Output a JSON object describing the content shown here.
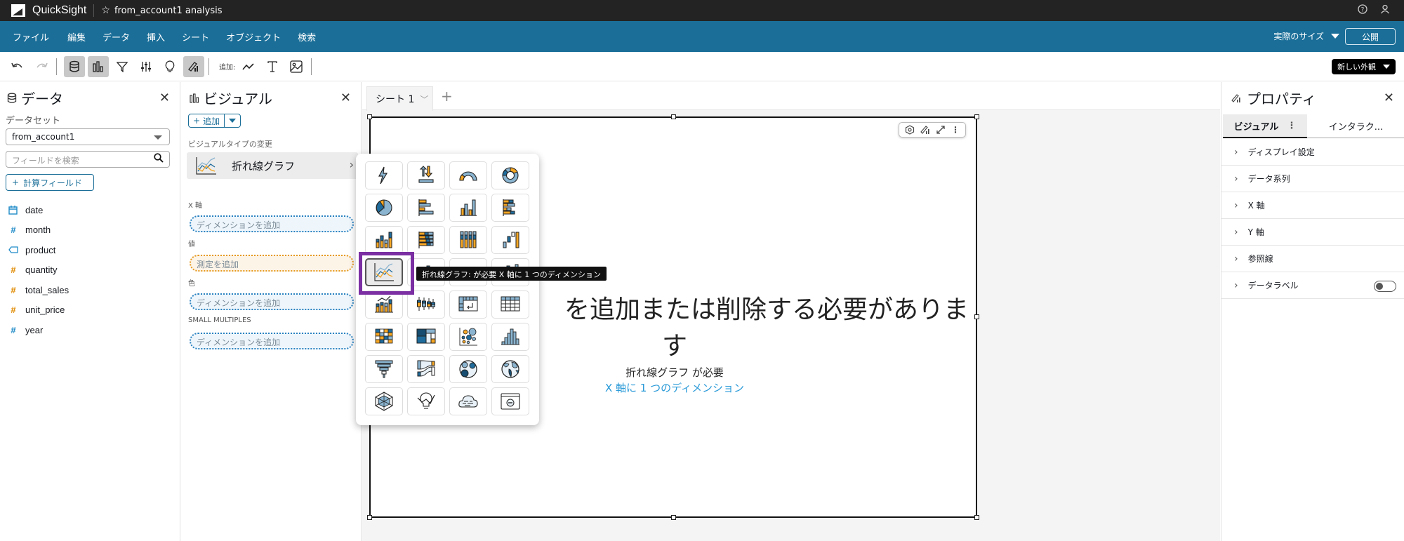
{
  "app": {
    "name": "QuickSight",
    "analysis_title": "from_account1 analysis",
    "icons": [
      "help-icon",
      "user-icon"
    ]
  },
  "menubar": {
    "items": [
      "ファイル",
      "編集",
      "データ",
      "挿入",
      "シート",
      "オブジェクト",
      "検索"
    ],
    "size_selector": "実際のサイズ",
    "publish": "公開"
  },
  "toolbar": {
    "add_label": "追加:",
    "new_look": "新しい外観"
  },
  "data_panel": {
    "title": "データ",
    "dataset_label": "データセット",
    "dataset_value": "from_account1",
    "search_placeholder": "フィールドを検索",
    "calc_field_label": "計算フィールド",
    "fields": [
      {
        "name": "date",
        "type": "date",
        "icon": "calendar-icon",
        "color": "#1f8bc8"
      },
      {
        "name": "month",
        "type": "dimension-number",
        "icon": "hash-icon",
        "color": "#1f8bc8"
      },
      {
        "name": "product",
        "type": "string",
        "icon": "tag-icon",
        "color": "#1f8bc8"
      },
      {
        "name": "quantity",
        "type": "measure",
        "icon": "hash-icon",
        "color": "#e08a00"
      },
      {
        "name": "total_sales",
        "type": "measure",
        "icon": "hash-icon",
        "color": "#e08a00"
      },
      {
        "name": "unit_price",
        "type": "measure",
        "icon": "hash-icon",
        "color": "#e08a00"
      },
      {
        "name": "year",
        "type": "dimension-number",
        "icon": "hash-icon",
        "color": "#1f8bc8"
      }
    ]
  },
  "visual_panel": {
    "title": "ビジュアル",
    "add_label": "追加",
    "change_type_label": "ビジュアルタイプの変更",
    "current_type": "折れ線グラフ",
    "wells": [
      {
        "label": "X 軸",
        "placeholder": "ディメンションを追加",
        "kind": "dimension"
      },
      {
        "label": "値",
        "placeholder": "測定を追加",
        "kind": "measure"
      },
      {
        "label": "色",
        "placeholder": "ディメンションを追加",
        "kind": "dimension"
      },
      {
        "label": "SMALL MULTIPLES",
        "placeholder": "ディメンションを追加",
        "kind": "dimension"
      }
    ]
  },
  "sheet": {
    "tab_label": "シート 1"
  },
  "visual": {
    "message_line1": "を追加または削除する必要がありま",
    "message_line2": "す",
    "required_text": "折れ線グラフ が必要",
    "required_link": "X 軸に 1 つのディメンション"
  },
  "picker": {
    "tooltip": "折れ線グラフ: が必要 X 軸に 1 つのディメンション",
    "selected": "line-chart",
    "types": [
      "kpi",
      "waterfall",
      "gauge",
      "donut",
      "pie",
      "horizontal-bar",
      "vertical-bar",
      "horizontal-stacked-bar",
      "vertical-stacked-bar",
      "horizontal-100-stacked-bar",
      "vertical-100-stacked-bar",
      "waterfall-steps",
      "line-chart",
      "combo-bar",
      "combo-bar-2",
      "combo-bar-3",
      "combo-line-bar",
      "box-plot",
      "pivot-table",
      "table",
      "heat-map",
      "tree-map",
      "scatter-plot",
      "histogram",
      "funnel",
      "sankey",
      "points-on-map",
      "filled-map",
      "radar",
      "insight",
      "word-cloud",
      "custom-visual"
    ]
  },
  "properties": {
    "title": "プロパティ",
    "tabs": [
      "ビジュアル",
      "インタラク..."
    ],
    "sections": [
      "ディスプレイ設定",
      "データ系列",
      "X 軸",
      "Y 軸",
      "参照線",
      "データラベル"
    ],
    "data_label_toggle": false
  },
  "colors": {
    "menubar": "#1a6e98",
    "topbar": "#232323",
    "accent": "#1a6e98",
    "selection": "#7b2fa3",
    "link": "#2a9ad8"
  }
}
